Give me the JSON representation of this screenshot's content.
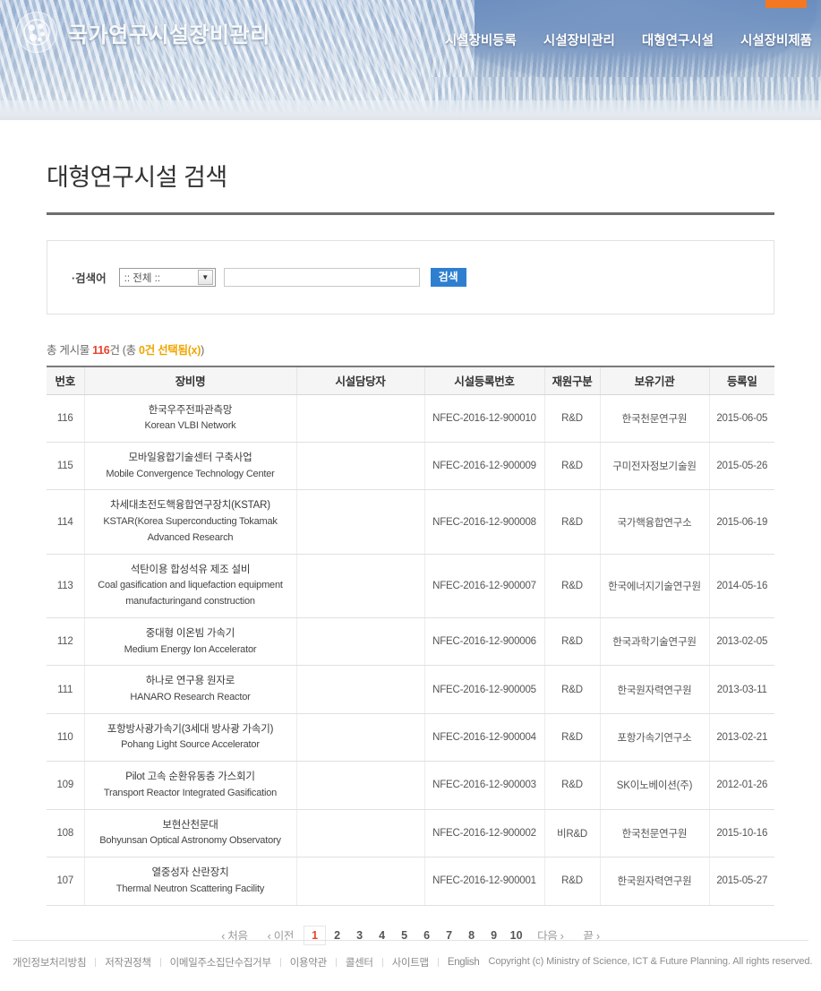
{
  "header": {
    "logo_text": "국가연구시설장비관리",
    "logo_icon": "gear-emblem-icon",
    "nav": [
      {
        "label": "시설장비등록"
      },
      {
        "label": "시설장비관리"
      },
      {
        "label": "대형연구시설"
      },
      {
        "label": "시설장비제품"
      }
    ],
    "accent_color": "#f47721"
  },
  "main": {
    "page_title": "대형연구시설 검색"
  },
  "search": {
    "label": "·검색어",
    "select_value": ":: 전체 ::",
    "caret_icon": "chevron-down-icon",
    "input_value": "",
    "input_placeholder": "",
    "button_label": "검색"
  },
  "result_count": {
    "prefix": "총 게시물 ",
    "total": "116",
    "middle": "건 (총 ",
    "selected": "0건 선택됨",
    "x_label": "(x)",
    "suffix": ")"
  },
  "table": {
    "columns": [
      "번호",
      "장비명",
      "시설담당자",
      "시설등록번호",
      "재원구분",
      "보유기관",
      "등록일"
    ],
    "rows": [
      {
        "no": "116",
        "name_ko": "한국우주전파관측망",
        "name_en": "Korean VLBI Network",
        "manager": "",
        "reg_no": "NFEC-2016-12-900010",
        "fund_type": "R&D",
        "org": "한국천문연구원",
        "reg_date": "2015-06-05"
      },
      {
        "no": "115",
        "name_ko": "모바일융합기술센터 구축사업",
        "name_en": "Mobile Convergence Technology Center",
        "manager": "",
        "reg_no": "NFEC-2016-12-900009",
        "fund_type": "R&D",
        "org": "구미전자정보기술원",
        "reg_date": "2015-05-26"
      },
      {
        "no": "114",
        "name_ko": "차세대초전도핵융합연구장치(KSTAR)",
        "name_en": "KSTAR(Korea Superconducting Tokamak Advanced Research",
        "manager": "",
        "reg_no": "NFEC-2016-12-900008",
        "fund_type": "R&D",
        "org": "국가핵융합연구소",
        "reg_date": "2015-06-19"
      },
      {
        "no": "113",
        "name_ko": "석탄이용 합성석유 제조 설비",
        "name_en": "Coal gasification and liquefaction equipment manufacturingand construction",
        "manager": "",
        "reg_no": "NFEC-2016-12-900007",
        "fund_type": "R&D",
        "org": "한국에너지기술연구원",
        "reg_date": "2014-05-16"
      },
      {
        "no": "112",
        "name_ko": "중대형 이온빔 가속기",
        "name_en": "Medium Energy Ion Accelerator",
        "manager": "",
        "reg_no": "NFEC-2016-12-900006",
        "fund_type": "R&D",
        "org": "한국과학기술연구원",
        "reg_date": "2013-02-05"
      },
      {
        "no": "111",
        "name_ko": "하나로 연구용 원자로",
        "name_en": "HANARO Research Reactor",
        "manager": "",
        "reg_no": "NFEC-2016-12-900005",
        "fund_type": "R&D",
        "org": "한국원자력연구원",
        "reg_date": "2013-03-11"
      },
      {
        "no": "110",
        "name_ko": "포항방사광가속기(3세대 방사광 가속기)",
        "name_en": "Pohang Light Source Accelerator",
        "manager": "",
        "reg_no": "NFEC-2016-12-900004",
        "fund_type": "R&D",
        "org": "포항가속기연구소",
        "reg_date": "2013-02-21"
      },
      {
        "no": "109",
        "name_ko": "Pilot 고속 순환유동층 가스회기",
        "name_en": "Transport Reactor Integrated Gasification",
        "manager": "",
        "reg_no": "NFEC-2016-12-900003",
        "fund_type": "R&D",
        "org": "SK이노베이션(주)",
        "reg_date": "2012-01-26"
      },
      {
        "no": "108",
        "name_ko": "보현산천문대",
        "name_en": "Bohyunsan Optical Astronomy Observatory",
        "manager": "",
        "reg_no": "NFEC-2016-12-900002",
        "fund_type": "비R&D",
        "org": "한국천문연구원",
        "reg_date": "2015-10-16"
      },
      {
        "no": "107",
        "name_ko": "열중성자 산란장치",
        "name_en": "Thermal Neutron Scattering Facility",
        "manager": "",
        "reg_no": "NFEC-2016-12-900001",
        "fund_type": "R&D",
        "org": "한국원자력연구원",
        "reg_date": "2015-05-27"
      }
    ]
  },
  "pagination": {
    "first": "‹ 처음",
    "prev": "‹ 이전",
    "pages": [
      "1",
      "2",
      "3",
      "4",
      "5",
      "6",
      "7",
      "8",
      "9",
      "10"
    ],
    "active_page": "1",
    "next": "다음 ›",
    "last": "끝 ›",
    "active_color": "#e8422a"
  },
  "footer": {
    "links": [
      "개인정보처리방침",
      "저작권정책",
      "이메일주소집단수집거부",
      "이용약관",
      "콜센터",
      "사이트맵",
      "English"
    ],
    "copyright": "Copyright (c) Ministry of Science, ICT & Future Planning. All rights reserved."
  }
}
